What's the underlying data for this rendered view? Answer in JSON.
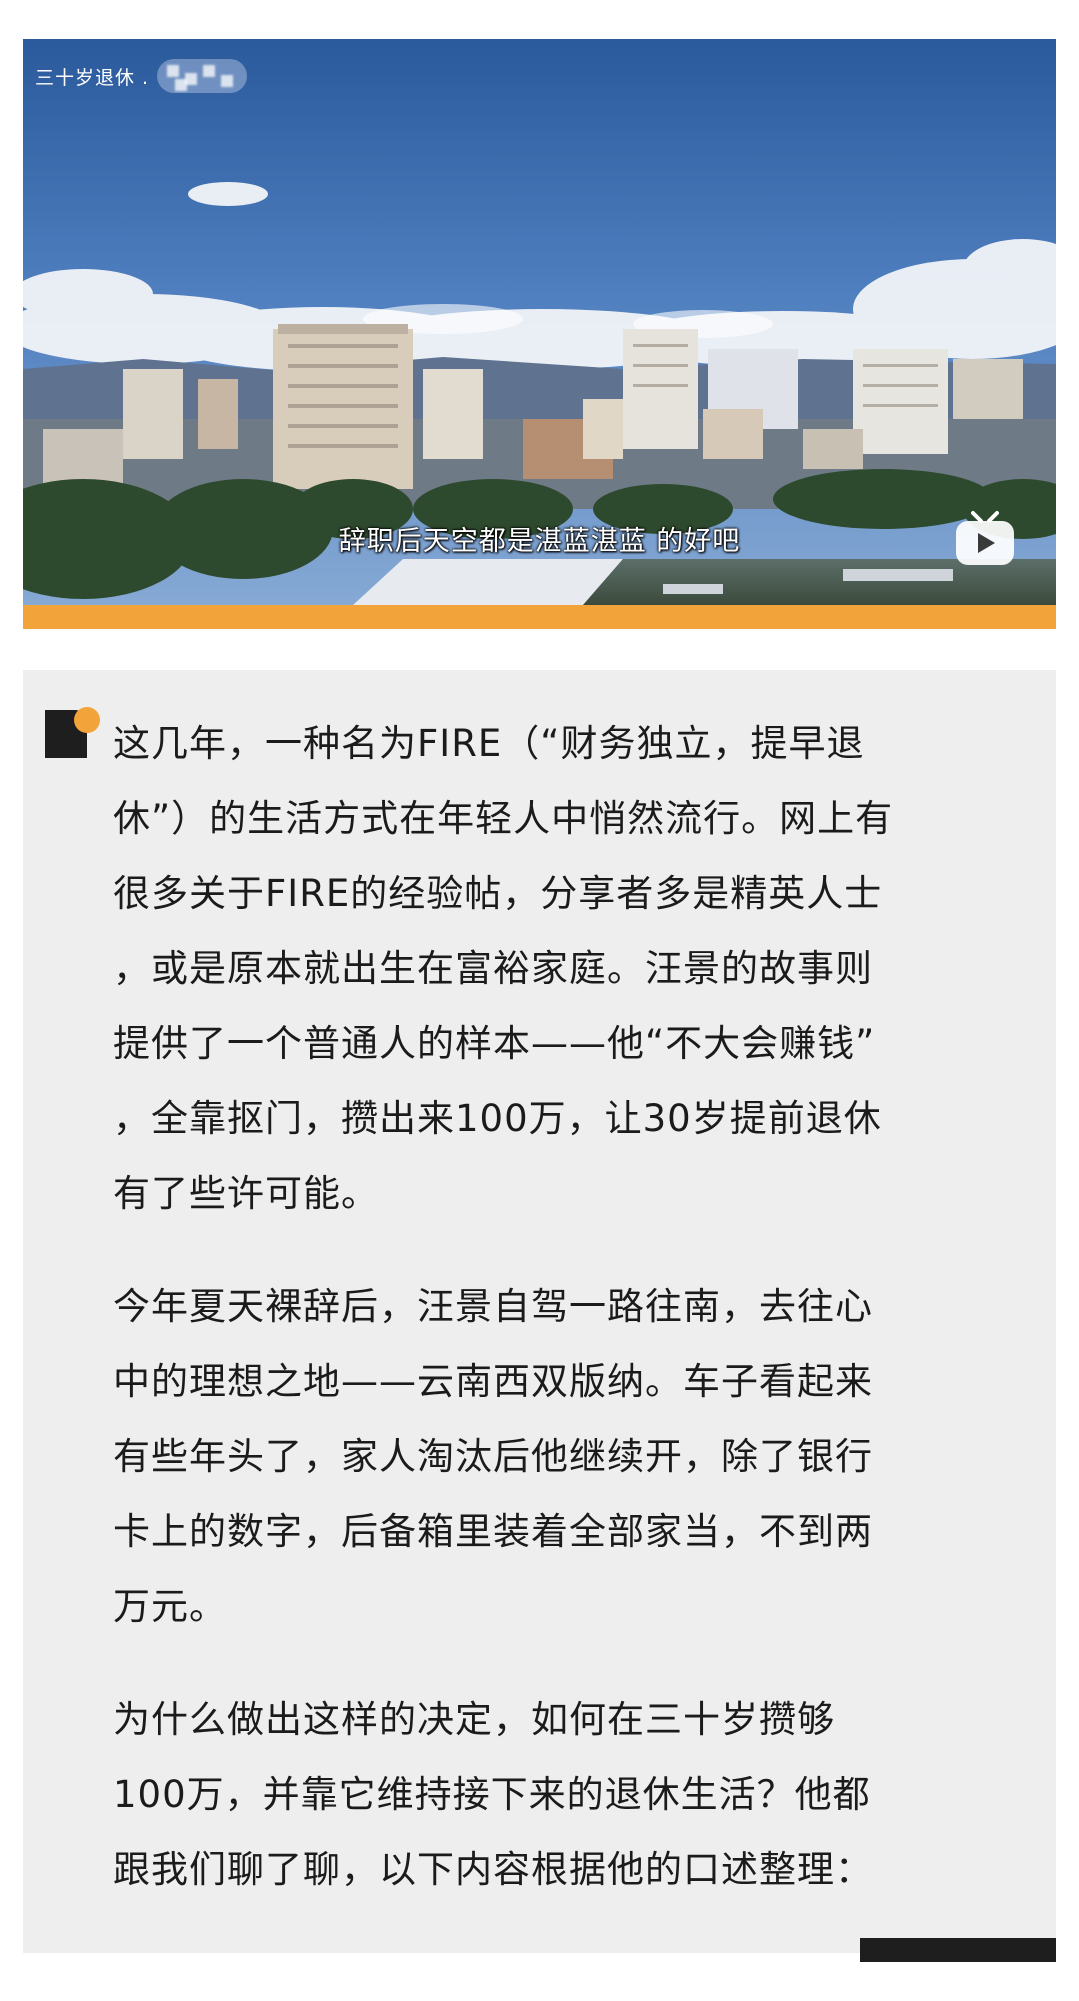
{
  "video": {
    "channel_label": "三十岁退休 .",
    "subtitle": "辞职后天空都是湛蓝湛蓝 的好吧",
    "play_icon": "tv-play-icon"
  },
  "colors": {
    "accent_bar": "#f2a33a",
    "card_background": "#eeeeee",
    "text": "#1b1b1b",
    "quote_mark_dark": "#1e1e1e",
    "quote_mark_dot": "#f2a33a"
  },
  "article": {
    "paragraphs": [
      "这几年，一种名为FIRE（“财务独立，提早退\n休”）的生活方式在年轻人中悄然流行。网上有\n很多关于FIRE的经验帖，分享者多是精英人士\n，或是原本就出生在富裕家庭。汪景的故事则\n提供了一个普通人的样本——他“不大会赚钱”\n，全靠抠门，攒出来100万，让30岁提前退休\n有了些许可能。",
      "今年夏天裸辞后，汪景自驾一路往南，去往心\n中的理想之地——云南西双版纳。车子看起来\n有些年头了，家人淘汰后他继续开，除了银行\n卡上的数字，后备箱里装着全部家当，不到两\n万元。",
      "为什么做出这样的决定，如何在三十岁攒够\n100万，并靠它维持接下来的退休生活？他都\n跟我们聊了聊，以下内容根据他的口述整理："
    ]
  }
}
